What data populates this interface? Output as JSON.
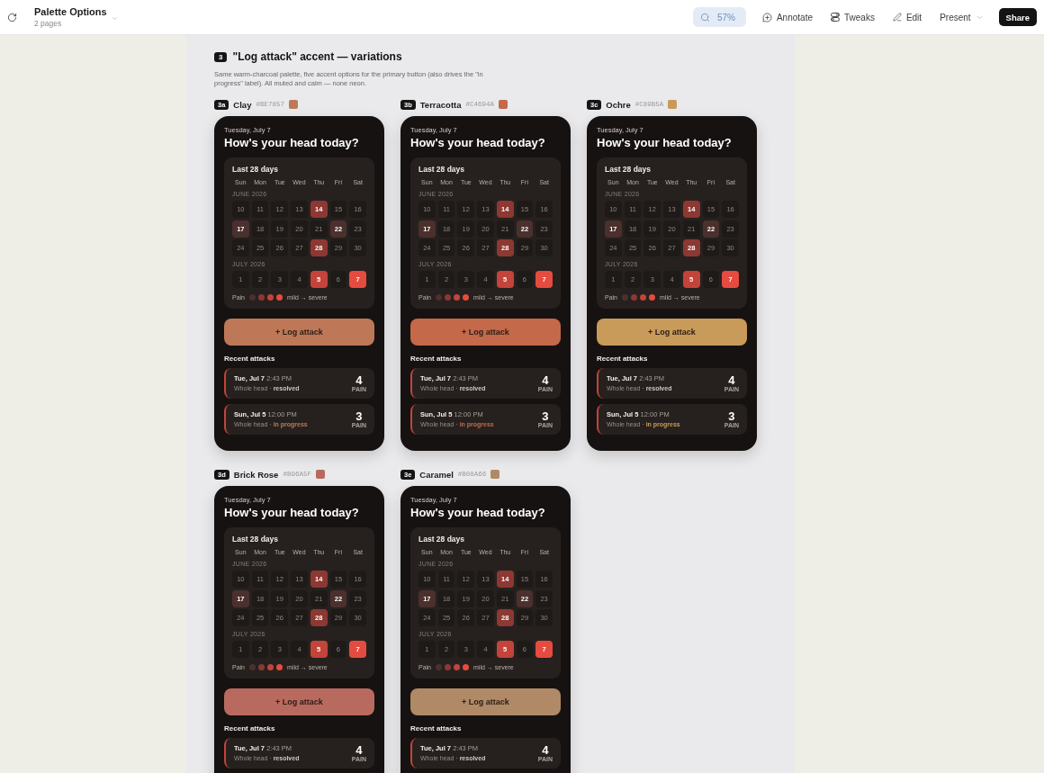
{
  "toolbar": {
    "title": "Palette Options",
    "subtitle": "2 pages",
    "zoom": "57%",
    "actions": [
      {
        "label": "Annotate",
        "kind": "annotate"
      },
      {
        "label": "Tweaks",
        "kind": "tweaks"
      },
      {
        "label": "Edit",
        "kind": "edit"
      },
      {
        "label": "Present",
        "kind": "dropdown"
      }
    ],
    "share": "Share"
  },
  "section": {
    "number": "3",
    "title": "\"Log attack\" accent — variations",
    "description": "Same warm-charcoal palette, five accent options for the primary button (also drives the \"in progress\" label). All muted and calm — none neon."
  },
  "variants": [
    {
      "tag": "3a",
      "name": "Clay",
      "hex": "#BE7857",
      "color": "#be7857",
      "phone": {
        "date": "Tuesday, July 7",
        "heading": "How's your head today?",
        "calendar": {
          "title": "Last 28 days",
          "weekdays": [
            "Sun",
            "Mon",
            "Tue",
            "Wed",
            "Thu",
            "Fri",
            "Sat"
          ],
          "months": [
            {
              "label": "JUNE 2026",
              "days": [
                {
                  "day": "10",
                  "color": "#1e1a18",
                  "logged": false
                },
                {
                  "day": "11",
                  "color": "#1e1a18",
                  "logged": false
                },
                {
                  "day": "12",
                  "color": "#1e1a18",
                  "logged": false
                },
                {
                  "day": "13",
                  "color": "#1e1a18",
                  "logged": false
                },
                {
                  "day": "14",
                  "color": "#8d3832",
                  "logged": true
                },
                {
                  "day": "15",
                  "color": "#1e1a18",
                  "logged": false
                },
                {
                  "day": "16",
                  "color": "#1e1a18",
                  "logged": false
                },
                {
                  "day": "17",
                  "color": "#4b302d",
                  "logged": true
                },
                {
                  "day": "18",
                  "color": "#1e1a18",
                  "logged": false
                },
                {
                  "day": "19",
                  "color": "#1e1a18",
                  "logged": false
                },
                {
                  "day": "20",
                  "color": "#1e1a18",
                  "logged": false
                },
                {
                  "day": "21",
                  "color": "#1e1a18",
                  "logged": false
                },
                {
                  "day": "22",
                  "color": "#4b302d",
                  "logged": true
                },
                {
                  "day": "23",
                  "color": "#1e1a18",
                  "logged": false
                },
                {
                  "day": "24",
                  "color": "#1e1a18",
                  "logged": false
                },
                {
                  "day": "25",
                  "color": "#1e1a18",
                  "logged": false
                },
                {
                  "day": "26",
                  "color": "#1e1a18",
                  "logged": false
                },
                {
                  "day": "27",
                  "color": "#1e1a18",
                  "logged": false
                },
                {
                  "day": "28",
                  "color": "#8d3832",
                  "logged": true
                },
                {
                  "day": "29",
                  "color": "#1e1a18",
                  "logged": false
                },
                {
                  "day": "30",
                  "color": "#1e1a18",
                  "logged": false
                }
              ]
            },
            {
              "label": "JULY 2026",
              "days": [
                {
                  "day": "1",
                  "color": "#1e1a18",
                  "logged": false
                },
                {
                  "day": "2",
                  "color": "#1e1a18",
                  "logged": false
                },
                {
                  "day": "3",
                  "color": "#1e1a18",
                  "logged": false
                },
                {
                  "day": "4",
                  "color": "#1e1a18",
                  "logged": false
                },
                {
                  "day": "5",
                  "color": "#c4433a",
                  "logged": true
                },
                {
                  "day": "6",
                  "color": "#1e1a18",
                  "logged": false
                },
                {
                  "day": "7",
                  "color": "#e64b3f",
                  "logged": true
                }
              ]
            }
          ],
          "legend": {
            "label": "Pain",
            "dots": [
              {
                "color": "#4b302d"
              },
              {
                "color": "#8d3832"
              },
              {
                "color": "#c4433a"
              },
              {
                "color": "#e64b3f"
              }
            ],
            "range": "mild → severe"
          }
        },
        "button": "+ Log attack",
        "recent_title": "Recent attacks",
        "recent": [
          {
            "date": "Tue, Jul 7",
            "time": "2:43 PM",
            "place": "Whole head ·",
            "status": "resolved",
            "active": false,
            "score": "4",
            "score_label": "PAIN"
          },
          {
            "date": "Sun, Jul 5",
            "time": "12:00 PM",
            "place": "Whole head ·",
            "status": "in progress",
            "active": true,
            "score": "3",
            "score_label": "PAIN"
          }
        ]
      }
    },
    {
      "tag": "3b",
      "name": "Terracotta",
      "hex": "#C4694A",
      "color": "#c4694a",
      "phone": {
        "date": "Tuesday, July 7",
        "heading": "How's your head today?",
        "calendar": {
          "title": "Last 28 days",
          "weekdays": [
            "Sun",
            "Mon",
            "Tue",
            "Wed",
            "Thu",
            "Fri",
            "Sat"
          ],
          "months": [
            {
              "label": "JUNE 2026",
              "days": [
                {
                  "day": "10",
                  "color": "#1e1a18",
                  "logged": false
                },
                {
                  "day": "11",
                  "color": "#1e1a18",
                  "logged": false
                },
                {
                  "day": "12",
                  "color": "#1e1a18",
                  "logged": false
                },
                {
                  "day": "13",
                  "color": "#1e1a18",
                  "logged": false
                },
                {
                  "day": "14",
                  "color": "#8d3832",
                  "logged": true
                },
                {
                  "day": "15",
                  "color": "#1e1a18",
                  "logged": false
                },
                {
                  "day": "16",
                  "color": "#1e1a18",
                  "logged": false
                },
                {
                  "day": "17",
                  "color": "#4b302d",
                  "logged": true
                },
                {
                  "day": "18",
                  "color": "#1e1a18",
                  "logged": false
                },
                {
                  "day": "19",
                  "color": "#1e1a18",
                  "logged": false
                },
                {
                  "day": "20",
                  "color": "#1e1a18",
                  "logged": false
                },
                {
                  "day": "21",
                  "color": "#1e1a18",
                  "logged": false
                },
                {
                  "day": "22",
                  "color": "#4b302d",
                  "logged": true
                },
                {
                  "day": "23",
                  "color": "#1e1a18",
                  "logged": false
                },
                {
                  "day": "24",
                  "color": "#1e1a18",
                  "logged": false
                },
                {
                  "day": "25",
                  "color": "#1e1a18",
                  "logged": false
                },
                {
                  "day": "26",
                  "color": "#1e1a18",
                  "logged": false
                },
                {
                  "day": "27",
                  "color": "#1e1a18",
                  "logged": false
                },
                {
                  "day": "28",
                  "color": "#8d3832",
                  "logged": true
                },
                {
                  "day": "29",
                  "color": "#1e1a18",
                  "logged": false
                },
                {
                  "day": "30",
                  "color": "#1e1a18",
                  "logged": false
                }
              ]
            },
            {
              "label": "JULY 2026",
              "days": [
                {
                  "day": "1",
                  "color": "#1e1a18",
                  "logged": false
                },
                {
                  "day": "2",
                  "color": "#1e1a18",
                  "logged": false
                },
                {
                  "day": "3",
                  "color": "#1e1a18",
                  "logged": false
                },
                {
                  "day": "4",
                  "color": "#1e1a18",
                  "logged": false
                },
                {
                  "day": "5",
                  "color": "#c4433a",
                  "logged": true
                },
                {
                  "day": "6",
                  "color": "#1e1a18",
                  "logged": false
                },
                {
                  "day": "7",
                  "color": "#e64b3f",
                  "logged": true
                }
              ]
            }
          ],
          "legend": {
            "label": "Pain",
            "dots": [
              {
                "color": "#4b302d"
              },
              {
                "color": "#8d3832"
              },
              {
                "color": "#c4433a"
              },
              {
                "color": "#e64b3f"
              }
            ],
            "range": "mild → severe"
          }
        },
        "button": "+ Log attack",
        "recent_title": "Recent attacks",
        "recent": [
          {
            "date": "Tue, Jul 7",
            "time": "2:43 PM",
            "place": "Whole head ·",
            "status": "resolved",
            "active": false,
            "score": "4",
            "score_label": "PAIN"
          },
          {
            "date": "Sun, Jul 5",
            "time": "12:00 PM",
            "place": "Whole head ·",
            "status": "in progress",
            "active": true,
            "score": "3",
            "score_label": "PAIN"
          }
        ]
      }
    },
    {
      "tag": "3c",
      "name": "Ochre",
      "hex": "#C89B5A",
      "color": "#c89b5a",
      "phone": {
        "date": "Tuesday, July 7",
        "heading": "How's your head today?",
        "calendar": {
          "title": "Last 28 days",
          "weekdays": [
            "Sun",
            "Mon",
            "Tue",
            "Wed",
            "Thu",
            "Fri",
            "Sat"
          ],
          "months": [
            {
              "label": "JUNE 2026",
              "days": [
                {
                  "day": "10",
                  "color": "#1e1a18",
                  "logged": false
                },
                {
                  "day": "11",
                  "color": "#1e1a18",
                  "logged": false
                },
                {
                  "day": "12",
                  "color": "#1e1a18",
                  "logged": false
                },
                {
                  "day": "13",
                  "color": "#1e1a18",
                  "logged": false
                },
                {
                  "day": "14",
                  "color": "#8d3832",
                  "logged": true
                },
                {
                  "day": "15",
                  "color": "#1e1a18",
                  "logged": false
                },
                {
                  "day": "16",
                  "color": "#1e1a18",
                  "logged": false
                },
                {
                  "day": "17",
                  "color": "#4b302d",
                  "logged": true
                },
                {
                  "day": "18",
                  "color": "#1e1a18",
                  "logged": false
                },
                {
                  "day": "19",
                  "color": "#1e1a18",
                  "logged": false
                },
                {
                  "day": "20",
                  "color": "#1e1a18",
                  "logged": false
                },
                {
                  "day": "21",
                  "color": "#1e1a18",
                  "logged": false
                },
                {
                  "day": "22",
                  "color": "#4b302d",
                  "logged": true
                },
                {
                  "day": "23",
                  "color": "#1e1a18",
                  "logged": false
                },
                {
                  "day": "24",
                  "color": "#1e1a18",
                  "logged": false
                },
                {
                  "day": "25",
                  "color": "#1e1a18",
                  "logged": false
                },
                {
                  "day": "26",
                  "color": "#1e1a18",
                  "logged": false
                },
                {
                  "day": "27",
                  "color": "#1e1a18",
                  "logged": false
                },
                {
                  "day": "28",
                  "color": "#8d3832",
                  "logged": true
                },
                {
                  "day": "29",
                  "color": "#1e1a18",
                  "logged": false
                },
                {
                  "day": "30",
                  "color": "#1e1a18",
                  "logged": false
                }
              ]
            },
            {
              "label": "JULY 2026",
              "days": [
                {
                  "day": "1",
                  "color": "#1e1a18",
                  "logged": false
                },
                {
                  "day": "2",
                  "color": "#1e1a18",
                  "logged": false
                },
                {
                  "day": "3",
                  "color": "#1e1a18",
                  "logged": false
                },
                {
                  "day": "4",
                  "color": "#1e1a18",
                  "logged": false
                },
                {
                  "day": "5",
                  "color": "#c4433a",
                  "logged": true
                },
                {
                  "day": "6",
                  "color": "#1e1a18",
                  "logged": false
                },
                {
                  "day": "7",
                  "color": "#e64b3f",
                  "logged": true
                }
              ]
            }
          ],
          "legend": {
            "label": "Pain",
            "dots": [
              {
                "color": "#4b302d"
              },
              {
                "color": "#8d3832"
              },
              {
                "color": "#c4433a"
              },
              {
                "color": "#e64b3f"
              }
            ],
            "range": "mild → severe"
          }
        },
        "button": "+ Log attack",
        "recent_title": "Recent attacks",
        "recent": [
          {
            "date": "Tue, Jul 7",
            "time": "2:43 PM",
            "place": "Whole head ·",
            "status": "resolved",
            "active": false,
            "score": "4",
            "score_label": "PAIN"
          },
          {
            "date": "Sun, Jul 5",
            "time": "12:00 PM",
            "place": "Whole head ·",
            "status": "in progress",
            "active": true,
            "score": "3",
            "score_label": "PAIN"
          }
        ]
      }
    },
    {
      "tag": "3d",
      "name": "Brick Rose",
      "hex": "#B96A5F",
      "color": "#b96a5f",
      "phone": {
        "date": "Tuesday, July 7",
        "heading": "How's your head today?",
        "calendar": {
          "title": "Last 28 days",
          "weekdays": [
            "Sun",
            "Mon",
            "Tue",
            "Wed",
            "Thu",
            "Fri",
            "Sat"
          ],
          "months": [
            {
              "label": "JUNE 2026",
              "days": [
                {
                  "day": "10",
                  "color": "#1e1a18",
                  "logged": false
                },
                {
                  "day": "11",
                  "color": "#1e1a18",
                  "logged": false
                },
                {
                  "day": "12",
                  "color": "#1e1a18",
                  "logged": false
                },
                {
                  "day": "13",
                  "color": "#1e1a18",
                  "logged": false
                },
                {
                  "day": "14",
                  "color": "#8d3832",
                  "logged": true
                },
                {
                  "day": "15",
                  "color": "#1e1a18",
                  "logged": false
                },
                {
                  "day": "16",
                  "color": "#1e1a18",
                  "logged": false
                },
                {
                  "day": "17",
                  "color": "#4b302d",
                  "logged": true
                },
                {
                  "day": "18",
                  "color": "#1e1a18",
                  "logged": false
                },
                {
                  "day": "19",
                  "color": "#1e1a18",
                  "logged": false
                },
                {
                  "day": "20",
                  "color": "#1e1a18",
                  "logged": false
                },
                {
                  "day": "21",
                  "color": "#1e1a18",
                  "logged": false
                },
                {
                  "day": "22",
                  "color": "#4b302d",
                  "logged": true
                },
                {
                  "day": "23",
                  "color": "#1e1a18",
                  "logged": false
                },
                {
                  "day": "24",
                  "color": "#1e1a18",
                  "logged": false
                },
                {
                  "day": "25",
                  "color": "#1e1a18",
                  "logged": false
                },
                {
                  "day": "26",
                  "color": "#1e1a18",
                  "logged": false
                },
                {
                  "day": "27",
                  "color": "#1e1a18",
                  "logged": false
                },
                {
                  "day": "28",
                  "color": "#8d3832",
                  "logged": true
                },
                {
                  "day": "29",
                  "color": "#1e1a18",
                  "logged": false
                },
                {
                  "day": "30",
                  "color": "#1e1a18",
                  "logged": false
                }
              ]
            },
            {
              "label": "JULY 2026",
              "days": [
                {
                  "day": "1",
                  "color": "#1e1a18",
                  "logged": false
                },
                {
                  "day": "2",
                  "color": "#1e1a18",
                  "logged": false
                },
                {
                  "day": "3",
                  "color": "#1e1a18",
                  "logged": false
                },
                {
                  "day": "4",
                  "color": "#1e1a18",
                  "logged": false
                },
                {
                  "day": "5",
                  "color": "#c4433a",
                  "logged": true
                },
                {
                  "day": "6",
                  "color": "#1e1a18",
                  "logged": false
                },
                {
                  "day": "7",
                  "color": "#e64b3f",
                  "logged": true
                }
              ]
            }
          ],
          "legend": {
            "label": "Pain",
            "dots": [
              {
                "color": "#4b302d"
              },
              {
                "color": "#8d3832"
              },
              {
                "color": "#c4433a"
              },
              {
                "color": "#e64b3f"
              }
            ],
            "range": "mild → severe"
          }
        },
        "button": "+ Log attack",
        "recent_title": "Recent attacks",
        "recent": [
          {
            "date": "Tue, Jul 7",
            "time": "2:43 PM",
            "place": "Whole head ·",
            "status": "resolved",
            "active": false,
            "score": "4",
            "score_label": "PAIN"
          }
        ]
      }
    },
    {
      "tag": "3e",
      "name": "Caramel",
      "hex": "#B08A66",
      "color": "#b08a66",
      "phone": {
        "date": "Tuesday, July 7",
        "heading": "How's your head today?",
        "calendar": {
          "title": "Last 28 days",
          "weekdays": [
            "Sun",
            "Mon",
            "Tue",
            "Wed",
            "Thu",
            "Fri",
            "Sat"
          ],
          "months": [
            {
              "label": "JUNE 2026",
              "days": [
                {
                  "day": "10",
                  "color": "#1e1a18",
                  "logged": false
                },
                {
                  "day": "11",
                  "color": "#1e1a18",
                  "logged": false
                },
                {
                  "day": "12",
                  "color": "#1e1a18",
                  "logged": false
                },
                {
                  "day": "13",
                  "color": "#1e1a18",
                  "logged": false
                },
                {
                  "day": "14",
                  "color": "#8d3832",
                  "logged": true
                },
                {
                  "day": "15",
                  "color": "#1e1a18",
                  "logged": false
                },
                {
                  "day": "16",
                  "color": "#1e1a18",
                  "logged": false
                },
                {
                  "day": "17",
                  "color": "#4b302d",
                  "logged": true
                },
                {
                  "day": "18",
                  "color": "#1e1a18",
                  "logged": false
                },
                {
                  "day": "19",
                  "color": "#1e1a18",
                  "logged": false
                },
                {
                  "day": "20",
                  "color": "#1e1a18",
                  "logged": false
                },
                {
                  "day": "21",
                  "color": "#1e1a18",
                  "logged": false
                },
                {
                  "day": "22",
                  "color": "#4b302d",
                  "logged": true
                },
                {
                  "day": "23",
                  "color": "#1e1a18",
                  "logged": false
                },
                {
                  "day": "24",
                  "color": "#1e1a18",
                  "logged": false
                },
                {
                  "day": "25",
                  "color": "#1e1a18",
                  "logged": false
                },
                {
                  "day": "26",
                  "color": "#1e1a18",
                  "logged": false
                },
                {
                  "day": "27",
                  "color": "#1e1a18",
                  "logged": false
                },
                {
                  "day": "28",
                  "color": "#8d3832",
                  "logged": true
                },
                {
                  "day": "29",
                  "color": "#1e1a18",
                  "logged": false
                },
                {
                  "day": "30",
                  "color": "#1e1a18",
                  "logged": false
                }
              ]
            },
            {
              "label": "JULY 2026",
              "days": [
                {
                  "day": "1",
                  "color": "#1e1a18",
                  "logged": false
                },
                {
                  "day": "2",
                  "color": "#1e1a18",
                  "logged": false
                },
                {
                  "day": "3",
                  "color": "#1e1a18",
                  "logged": false
                },
                {
                  "day": "4",
                  "color": "#1e1a18",
                  "logged": false
                },
                {
                  "day": "5",
                  "color": "#c4433a",
                  "logged": true
                },
                {
                  "day": "6",
                  "color": "#1e1a18",
                  "logged": false
                },
                {
                  "day": "7",
                  "color": "#e64b3f",
                  "logged": true
                }
              ]
            }
          ],
          "legend": {
            "label": "Pain",
            "dots": [
              {
                "color": "#4b302d"
              },
              {
                "color": "#8d3832"
              },
              {
                "color": "#c4433a"
              },
              {
                "color": "#e64b3f"
              }
            ],
            "range": "mild → severe"
          }
        },
        "button": "+ Log attack",
        "recent_title": "Recent attacks",
        "recent": [
          {
            "date": "Tue, Jul 7",
            "time": "2:43 PM",
            "place": "Whole head ·",
            "status": "resolved",
            "active": false,
            "score": "4",
            "score_label": "PAIN"
          }
        ]
      }
    }
  ]
}
